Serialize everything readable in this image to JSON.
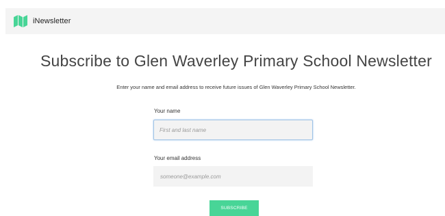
{
  "header": {
    "brand": "iNewsletter",
    "logo_icon": "map-icon",
    "accent_color": "#48d597"
  },
  "main": {
    "title": "Subscribe to Glen Waverley Primary School Newsletter",
    "subtitle": "Enter your name and email address to receive future issues of Glen Waverley Primary School Newsletter."
  },
  "form": {
    "name_label": "Your name",
    "name_placeholder": "First and last name",
    "email_label": "Your email address",
    "email_placeholder": "someone@example.com",
    "subscribe_label": "SUBSCRIBE"
  }
}
